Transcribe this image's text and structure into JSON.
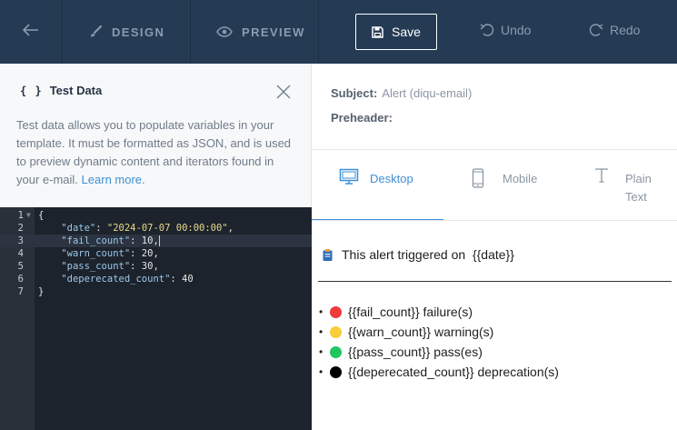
{
  "toolbar": {
    "design_label": "DESIGN",
    "preview_label": "PREVIEW",
    "save_label": "Save",
    "undo_label": "Undo",
    "redo_label": "Redo"
  },
  "test_data": {
    "title": "Test Data",
    "braces": "{ }",
    "description": "Test data allows you to populate variables in your template. It must be formatted as JSON, and is used to preview dynamic content and iterators found in your e-mail.",
    "learn_more": "Learn more."
  },
  "editor": {
    "active_line": 3,
    "lines": [
      {
        "num": "1",
        "text": "{"
      },
      {
        "num": "2",
        "text": "    \"date\": \"2024-07-07 00:00:00\","
      },
      {
        "num": "3",
        "text": "    \"fail_count\": 10,"
      },
      {
        "num": "4",
        "text": "    \"warn_count\": 20,"
      },
      {
        "num": "5",
        "text": "    \"pass_count\": 30,"
      },
      {
        "num": "6",
        "text": "    \"deperecated_count\": 40"
      },
      {
        "num": "7",
        "text": "}"
      }
    ]
  },
  "preview": {
    "subject_label": "Subject:",
    "subject_value": "Alert (diqu-email)",
    "preheader_label": "Preheader:",
    "tabs": {
      "desktop": "Desktop",
      "mobile": "Mobile",
      "plain": "Plain Text"
    },
    "alert_text": "This alert triggered on  {{date}}",
    "items": [
      {
        "text": "{{fail_count}} failure(s)",
        "color": "#ee3a3a"
      },
      {
        "text": "{{warn_count}} warning(s)",
        "color": "#f7cd3a"
      },
      {
        "text": "{{pass_count}} pass(es)",
        "color": "#21c55e"
      },
      {
        "text": "{{deperecated_count}} deprecation(s)",
        "color": "#000000"
      }
    ]
  },
  "colors": {
    "toolbar_bg": "#253b54",
    "accent": "#3d8fd6",
    "editor_bg": "#1d232c"
  }
}
